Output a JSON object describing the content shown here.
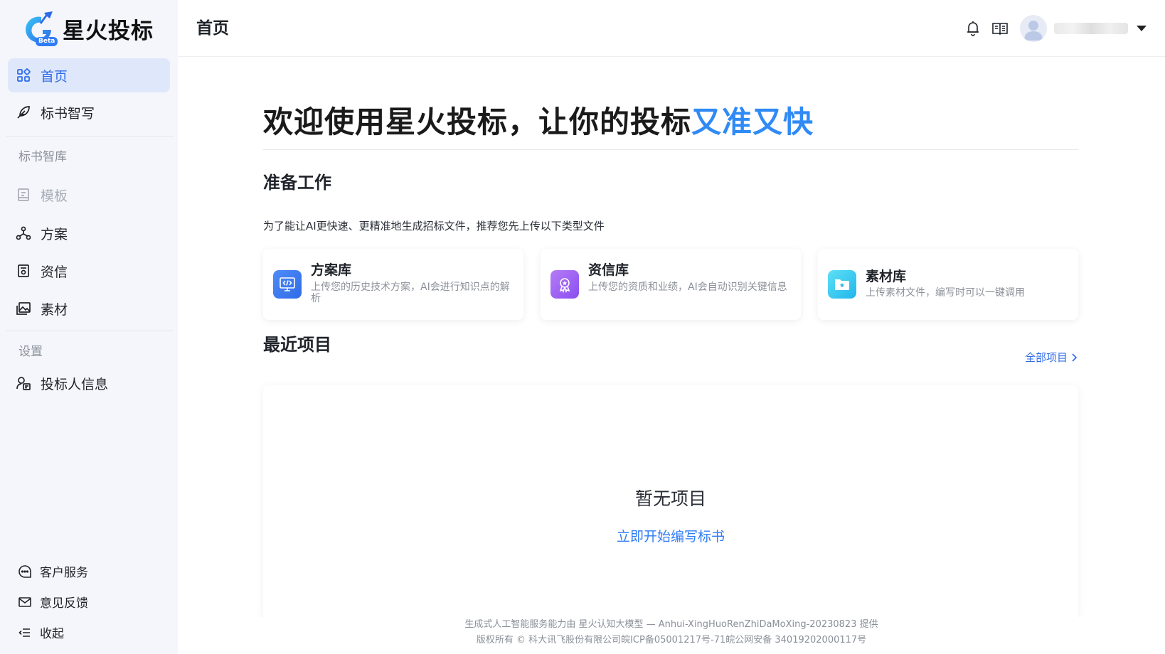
{
  "brand": {
    "name": "星火投标",
    "badge": "Beta"
  },
  "sidebar": {
    "items": [
      {
        "label": "首页",
        "icon": "grid-icon"
      },
      {
        "label": "标书智写",
        "icon": "quill-icon"
      }
    ],
    "group_library": "标书智库",
    "library_items": [
      {
        "label": "模板",
        "icon": "template-icon"
      },
      {
        "label": "方案",
        "icon": "nodes-icon"
      },
      {
        "label": "资信",
        "icon": "credential-icon"
      },
      {
        "label": "素材",
        "icon": "image-icon"
      }
    ],
    "group_settings": "设置",
    "settings_items": [
      {
        "label": "投标人信息",
        "icon": "bidder-icon"
      }
    ],
    "bottom": {
      "service": "客户服务",
      "feedback": "意见反馈",
      "collapse": "收起"
    }
  },
  "header": {
    "title": "首页"
  },
  "main": {
    "welcome_prefix": "欢迎使用星火投标，让你的投标",
    "welcome_highlight": "又准又快",
    "prepare_title": "准备工作",
    "prepare_desc": "为了能让AI更快速、更精准地生成招标文件，推荐您先上传以下类型文件",
    "cards": [
      {
        "title": "方案库",
        "desc": "上传您的历史技术方案，AI会进行知识点的解析"
      },
      {
        "title": "资信库",
        "desc": "上传您的资质和业绩，AI会自动识别关键信息"
      },
      {
        "title": "素材库",
        "desc": "上传素材文件，编写时可以一键调用"
      }
    ],
    "recent_title": "最近项目",
    "all_projects": "全部项目",
    "empty_title": "暂无项目",
    "empty_action": "立即开始编写标书"
  },
  "footer": {
    "line1": "生成式人工智能服务能力由 星火认知大模型 — Anhui-XingHuoRenZhiDaMoXing-20230823 提供",
    "line2": "版权所有 © 科大讯飞股份有限公司皖ICP备05001217号-71皖公网安备 34019202000117号"
  },
  "colors": {
    "accent": "#2f6be8",
    "highlight": "#2f8af5",
    "sidebar_bg": "#f4f6fb",
    "active_bg": "#dfe8fb"
  }
}
